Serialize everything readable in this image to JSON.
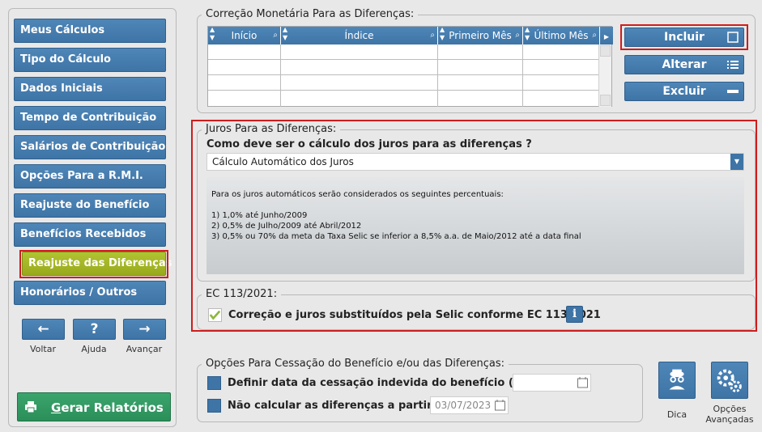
{
  "sidebar": {
    "items": [
      {
        "label": "Meus Cálculos"
      },
      {
        "label": "Tipo do Cálculo"
      },
      {
        "label": "Dados Iniciais"
      },
      {
        "label": "Tempo de Contribuição"
      },
      {
        "label": "Salários de Contribuição"
      },
      {
        "label": "Opções Para a R.M.I."
      },
      {
        "label": "Reajuste do Benefício"
      },
      {
        "label": "Benefícios Recebidos"
      },
      {
        "label": "Reajuste das Diferenças",
        "active": true
      },
      {
        "label": "Honorários / Outros"
      }
    ],
    "nav": {
      "back_label": "Voltar",
      "help_label": "Ajuda",
      "forward_label": "Avançar",
      "back_icon": "←",
      "help_icon": "?",
      "forward_icon": "→"
    },
    "report_label": "Gerar Relatórios"
  },
  "correction": {
    "title": "Correção Monetária Para as Diferenças:",
    "columns": [
      "Início",
      "Índice",
      "Primeiro Mês",
      "Último Mês"
    ],
    "rows": [],
    "buttons": {
      "include": "Incluir",
      "alter": "Alterar",
      "delete": "Excluir"
    }
  },
  "juros": {
    "title": "Juros Para as Diferenças:",
    "question": "Como deve ser o cálculo dos juros para as diferenças ?",
    "selected": "Cálculo Automático dos Juros",
    "info": {
      "intro": "Para os juros automáticos serão considerados os seguintes percentuais:",
      "lines": [
        "1) 1,0% até Junho/2009",
        "2) 0,5% de Julho/2009 até Abril/2012",
        "3) 0,5% ou 70% da meta da Taxa Selic se inferior a 8,5% a.a. de Maio/2012 até a data final"
      ]
    }
  },
  "ec": {
    "title": "EC 113/2021:",
    "checkbox_label": "Correção e juros substituídos pela Selic conforme EC 113/2021",
    "checked": true,
    "info_icon": "i"
  },
  "cessation": {
    "title": "Opções Para Cessação do Benefício e/ou das Diferenças:",
    "dcb_label": "Definir data da cessação indevida do benefício (DCB)",
    "dcb_value": "",
    "no_calc_label": "Não calcular as diferenças a partir de",
    "no_calc_value": "03/07/2023"
  },
  "tools": {
    "tip_label": "Dica",
    "advanced_label_1": "Opções",
    "advanced_label_2": "Avançadas"
  },
  "colors": {
    "primary": "#3e74a6",
    "active": "#98aa1b",
    "report": "#2b8e59",
    "highlight": "#cf1d1d"
  }
}
